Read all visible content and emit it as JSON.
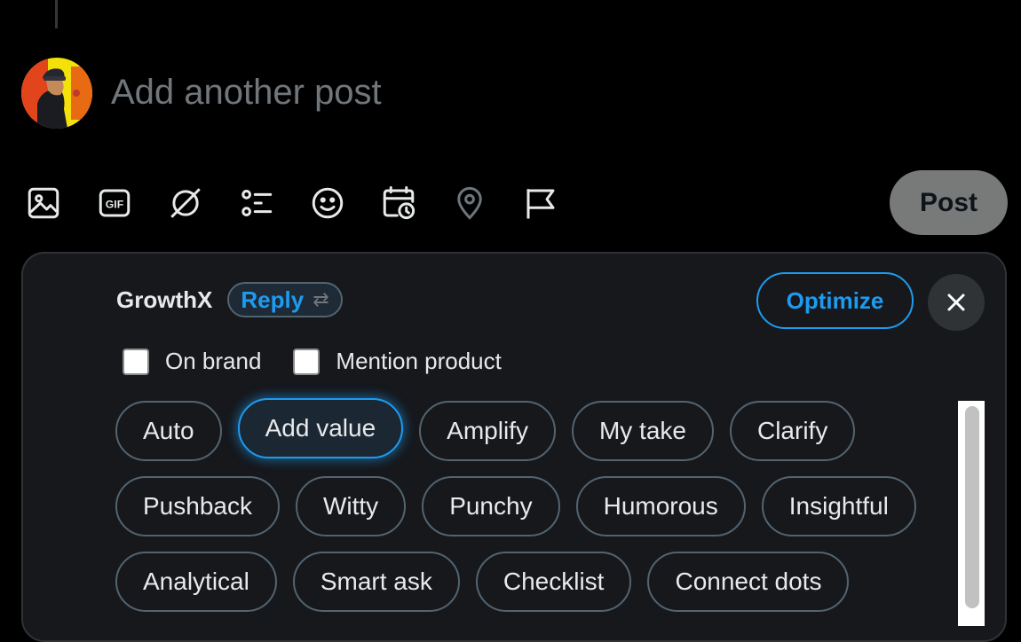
{
  "compose": {
    "placeholder": "Add another post",
    "post_label": "Post"
  },
  "toolbar": {
    "icons": [
      "image-icon",
      "gif-icon",
      "grok-icon",
      "poll-icon",
      "emoji-icon",
      "schedule-icon",
      "location-icon",
      "flag-icon"
    ]
  },
  "panel": {
    "brand": "GrowthX",
    "mode": "Reply",
    "mode_swap_glyph": "⇄",
    "optimize_label": "Optimize",
    "close_glyph": "✕",
    "options": [
      {
        "label": "On brand",
        "checked": false
      },
      {
        "label": "Mention product",
        "checked": false
      }
    ],
    "chips": [
      [
        "Auto",
        "Add value",
        "Amplify",
        "My take",
        "Clarify"
      ],
      [
        "Pushback",
        "Witty",
        "Punchy",
        "Humorous",
        "Insightful"
      ],
      [
        "Analytical",
        "Smart ask",
        "Checklist",
        "Connect dots"
      ]
    ],
    "active_chip": "Add value"
  },
  "colors": {
    "accent": "#1d9bf0",
    "background": "#000000",
    "panel": "#16181c",
    "muted": "#71767b"
  }
}
